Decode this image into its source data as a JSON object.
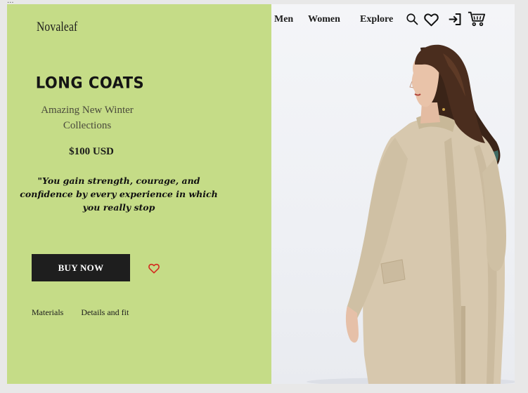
{
  "window": {
    "ellipsis": "..."
  },
  "brand": {
    "name": "Novaleaf"
  },
  "nav": {
    "links": [
      "Men",
      "Women",
      "Explore"
    ],
    "icons": [
      "search-icon",
      "heart-icon",
      "login-icon",
      "cart-icon"
    ]
  },
  "hero": {
    "headline": "LONG COATS",
    "subtitle": "Amazing   New Winter Collections",
    "price": "$100 USD",
    "quote": "\"You gain strength, courage, and confidence by every experience in which you really stop",
    "buy_label": "BUY NOW",
    "wishlist_icon": "heart-outline-icon"
  },
  "tabs": [
    "Materials",
    "Details and fit"
  ],
  "colors": {
    "panel": "#c5dc87",
    "button": "#1e1e1e",
    "wishlist_heart": "#d42a1e",
    "coat": "#d7c8ae",
    "hair": "#3a2418"
  }
}
